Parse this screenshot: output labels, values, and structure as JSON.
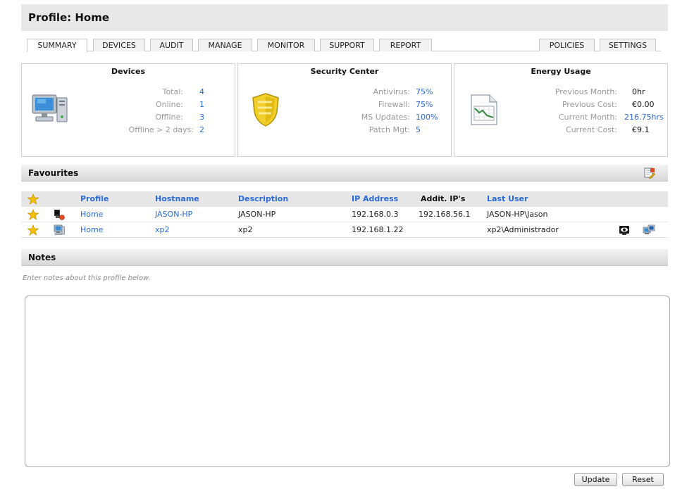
{
  "header": {
    "title": "Profile: Home"
  },
  "tabs": {
    "left": [
      "SUMMARY",
      "DEVICES",
      "AUDIT",
      "MANAGE",
      "MONITOR",
      "SUPPORT",
      "REPORT"
    ],
    "right": [
      "POLICIES",
      "SETTINGS"
    ],
    "active": "SUMMARY"
  },
  "devices": {
    "title": "Devices",
    "total_label": "Total:",
    "total": "4",
    "online_label": "Online:",
    "online": "1",
    "offline_label": "Offline:",
    "offline": "3",
    "offline2_label": "Offline > 2 days:",
    "offline2": "2"
  },
  "security": {
    "title": "Security Center",
    "antivirus_label": "Antivirus:",
    "antivirus": "75%",
    "firewall_label": "Firewall:",
    "firewall": "75%",
    "msupdates_label": "MS Updates:",
    "msupdates": "100%",
    "patch_label": "Patch Mgt:",
    "patch": "5"
  },
  "energy": {
    "title": "Energy Usage",
    "prev_month_label": "Previous Month:",
    "prev_month": "0hr",
    "prev_cost_label": "Previous Cost:",
    "prev_cost": "€0.00",
    "cur_month_label": "Current Month:",
    "cur_month": "216.75hrs",
    "cur_cost_label": "Current Cost:",
    "cur_cost": "€9.1"
  },
  "favourites": {
    "title": "Favourites",
    "columns": {
      "profile": "Profile",
      "hostname": "Hostname",
      "description": "Description",
      "ip": "IP Address",
      "addit_ip": "Addit. IP's",
      "last_user": "Last User"
    },
    "rows": [
      {
        "profile": "Home",
        "hostname": "JASON-HP",
        "description": "JASON-HP",
        "ip": "192.168.0.3",
        "addit_ip": "192.168.56.1",
        "last_user": "JASON-HP\\Jason"
      },
      {
        "profile": "Home",
        "hostname": "xp2",
        "description": "xp2",
        "ip": "192.168.1.22",
        "addit_ip": "",
        "last_user": "xp2\\Administrador"
      }
    ]
  },
  "notes": {
    "title": "Notes",
    "hint": "Enter notes about this profile below.",
    "value": ""
  },
  "buttons": {
    "update": "Update",
    "reset": "Reset"
  },
  "icons": {
    "computer": "computer-icon",
    "shield": "shield-icon",
    "chart": "energy-chart-icon",
    "star": "star-icon",
    "device_offline": "device-offline-icon",
    "device_online": "device-online-icon",
    "remote_view": "remote-view-icon",
    "remote_connect": "remote-connect-icon",
    "edit_favourites": "edit-favourites-icon"
  },
  "colors": {
    "link": "#2a6ad8",
    "star": "#f5c000",
    "shield": "#e8c41a"
  }
}
